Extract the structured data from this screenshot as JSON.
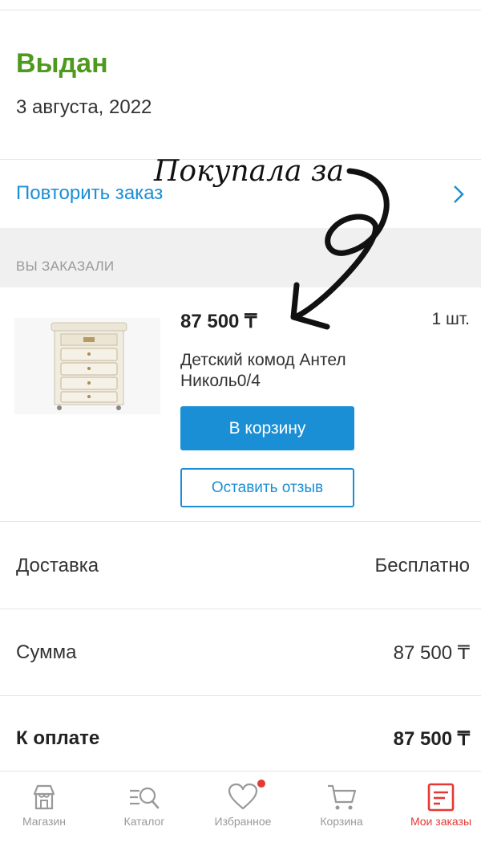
{
  "order": {
    "status": "Выдан",
    "date": "3 августа, 2022",
    "repeat_label": "Повторить заказ"
  },
  "section": {
    "ordered_header": "ВЫ ЗАКАЗАЛИ"
  },
  "product": {
    "price": "87 500 ₸",
    "quantity": "1 шт.",
    "name": "Детский комод Антел Николь0/4",
    "cart_button": "В корзину",
    "review_button": "Оставить отзыв"
  },
  "summary": {
    "delivery_label": "Доставка",
    "delivery_value": "Бесплатно",
    "sum_label": "Сумма",
    "sum_value": "87 500 ₸",
    "pay_label": "К оплате",
    "pay_value": "87 500 ₸"
  },
  "annotation": {
    "text": "Покупала за"
  },
  "tabbar": {
    "items": [
      {
        "label": "Магазин",
        "icon": "store-icon"
      },
      {
        "label": "Каталог",
        "icon": "catalog-search-icon"
      },
      {
        "label": "Избранное",
        "icon": "heart-icon"
      },
      {
        "label": "Корзина",
        "icon": "cart-icon"
      },
      {
        "label": "Мои заказы",
        "icon": "orders-icon"
      }
    ],
    "active_index": 4
  },
  "colors": {
    "status_green": "#4f9a1e",
    "accent_blue": "#1a8fd6",
    "active_red": "#e53935",
    "muted_gray": "#999999"
  }
}
